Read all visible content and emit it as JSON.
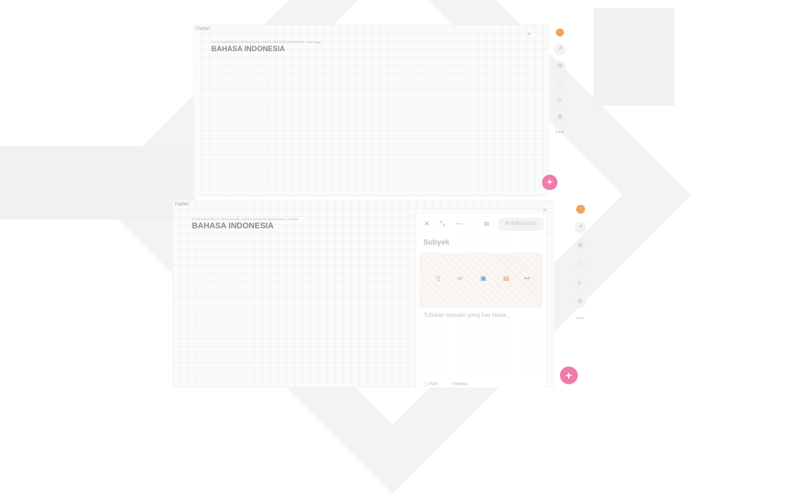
{
  "app_name": "Padlet",
  "top": {
    "breadcrumb": "ELITA BAHASA DI PERGURUAN TINGGI BAHASA INDONESIA • seminggu",
    "title": "BAHASA INDONESIA",
    "avatar_initial": "",
    "more": "•••",
    "fab": "+"
  },
  "bottom": {
    "breadcrumb": "ELITA BAHASA DI PERGURUAN TINGGI BAHASA INDONESIA • 3 menit",
    "title": "BAHASA INDONESIA",
    "more": "•••",
    "fab": "+"
  },
  "composer": {
    "close": "✕",
    "expand": "⤡",
    "minimize": "—",
    "publish_label": "Publikasikan",
    "subject_placeholder": "Subyek",
    "body_placeholder": "Tuliskan sesuatu yang luar biasa...",
    "footer_left": "◯ Putih",
    "footer_right": "+ Bidang"
  },
  "colors": {
    "avatar": "#f2a35c",
    "fab": "#f07aa8"
  }
}
